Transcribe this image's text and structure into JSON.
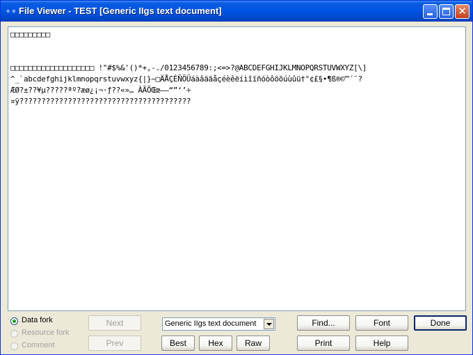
{
  "window": {
    "icon_glyph": "⚬⚬",
    "title": "File Viewer - TEST [Generic IIgs text document]"
  },
  "content": {
    "lines": [
      "□□□□□□□□□",
      "",
      "",
      "□□□□□□□□□□□□□□□□□□□ !\"#$%&'()*+,-./0123456789:;<=>?@ABCDEFGHIJKLMNOPQRSTUVWXYZ[\\]",
      "^_`abcdefghijklmnopqrstuvwxyz{|}~□ÄÅÇÉÑÖÜáàâäãåçéèêëíìîïñóòôöõúùûü†°¢£§•¶ß®©™´¨?",
      "ÆØ?±??¥µ?????ªº?æø¿¡¬·ƒ??«»… ÀÃÕŒœ–—“”‘’÷",
      "¤ÿ???????????????????????????????????????"
    ]
  },
  "fork": {
    "options": [
      {
        "label": "Data fork",
        "checked": true,
        "enabled": true
      },
      {
        "label": "Resource fork",
        "checked": false,
        "enabled": false
      },
      {
        "label": "Comment",
        "checked": false,
        "enabled": false
      }
    ]
  },
  "buttons": {
    "next": "Next",
    "prev": "Prev",
    "best": "Best",
    "hex": "Hex",
    "raw": "Raw",
    "find": "Find...",
    "font": "Font",
    "done": "Done",
    "print": "Print",
    "help": "Help"
  },
  "format_select": {
    "value": "Generic IIgs text document"
  }
}
